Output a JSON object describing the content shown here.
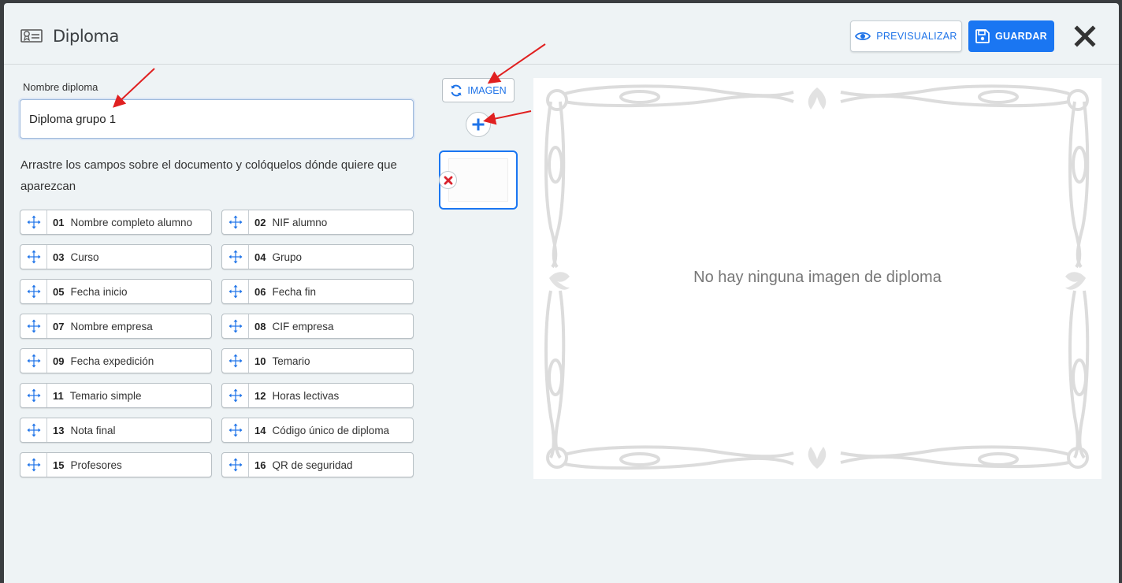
{
  "header": {
    "title": "Diploma",
    "preview_label": "PREVISUALIZAR",
    "save_label": "GUARDAR"
  },
  "form": {
    "name_label": "Nombre diploma",
    "name_value": "Diploma grupo 1",
    "instructions": "Arrastre los campos sobre el documento y colóquelos dónde quiere que aparezcan"
  },
  "fields": [
    {
      "num": "01",
      "label": "Nombre completo alumno"
    },
    {
      "num": "02",
      "label": "NIF alumno"
    },
    {
      "num": "03",
      "label": "Curso"
    },
    {
      "num": "04",
      "label": "Grupo"
    },
    {
      "num": "05",
      "label": "Fecha inicio"
    },
    {
      "num": "06",
      "label": "Fecha fin"
    },
    {
      "num": "07",
      "label": "Nombre empresa"
    },
    {
      "num": "08",
      "label": "CIF empresa"
    },
    {
      "num": "09",
      "label": "Fecha expedición"
    },
    {
      "num": "10",
      "label": "Temario"
    },
    {
      "num": "11",
      "label": "Temario simple"
    },
    {
      "num": "12",
      "label": "Horas lectivas"
    },
    {
      "num": "13",
      "label": "Nota final"
    },
    {
      "num": "14",
      "label": "Código único de diploma"
    },
    {
      "num": "15",
      "label": "Profesores"
    },
    {
      "num": "16",
      "label": "QR de seguridad"
    }
  ],
  "images": {
    "image_button_label": "IMAGEN"
  },
  "canvas": {
    "empty_message": "No hay ninguna imagen de diploma"
  },
  "colors": {
    "accent": "#1a76f2",
    "annotation_arrow": "#e02020",
    "delete": "#d9232d"
  }
}
